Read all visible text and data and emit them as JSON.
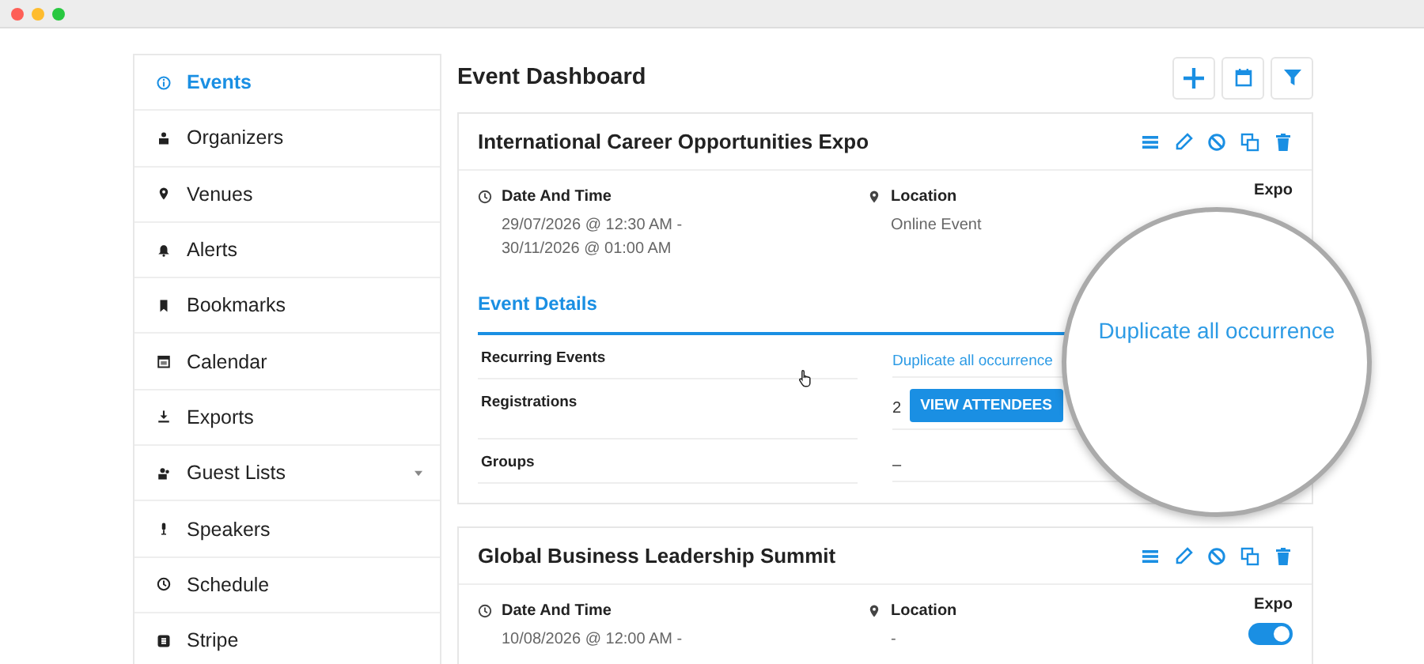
{
  "sidebar": {
    "items": [
      {
        "label": "Events",
        "selected": true
      },
      {
        "label": "Organizers",
        "selected": false
      },
      {
        "label": "Venues",
        "selected": false
      },
      {
        "label": "Alerts",
        "selected": false
      },
      {
        "label": "Bookmarks",
        "selected": false
      },
      {
        "label": "Calendar",
        "selected": false
      },
      {
        "label": "Exports",
        "selected": false
      },
      {
        "label": "Guest Lists",
        "selected": false,
        "has_submenu": true
      },
      {
        "label": "Speakers",
        "selected": false
      },
      {
        "label": "Schedule",
        "selected": false
      },
      {
        "label": "Stripe",
        "selected": false
      }
    ]
  },
  "page_title": "Event Dashboard",
  "events": [
    {
      "title": "International Career Opportunities Expo",
      "date_label": "Date And Time",
      "date_lines": [
        "29/07/2026 @ 12:30 AM -",
        "30/11/2026 @ 01:00 AM"
      ],
      "location_label": "Location",
      "location": "Online Event",
      "expo_label": "Expo",
      "details": {
        "tab": "Event Details",
        "rows": [
          {
            "label": "Recurring Events",
            "kind": "link",
            "value": "Duplicate all occurrence"
          },
          {
            "label": "Registrations",
            "kind": "button",
            "value": "2",
            "button": "VIEW ATTENDEES"
          },
          {
            "label": "Groups",
            "kind": "text",
            "value": "–"
          }
        ]
      }
    },
    {
      "title": "Global Business Leadership Summit",
      "date_label": "Date And Time",
      "date_lines": [
        "10/08/2026 @ 12:00 AM -"
      ],
      "location_label": "Location",
      "location": "-",
      "expo_label": "Expo",
      "expo_on": true
    }
  ],
  "magnifier": {
    "text": "Duplicate all occurrence"
  }
}
